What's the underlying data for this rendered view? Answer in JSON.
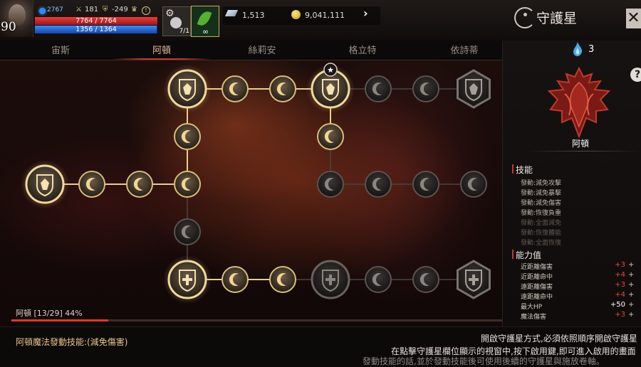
{
  "player": {
    "level": "90",
    "power": "2767",
    "stat_attack": "181",
    "stat_defense": "-249",
    "hp": "7764 / 7764",
    "mp": "1356 / 1364",
    "hp_ratio": 1.0,
    "mp_ratio": 0.994
  },
  "items": {
    "slot1_count": "7/1",
    "slot2_count": "∞"
  },
  "currency": {
    "diamond": "1,513",
    "gold": "9,041,111"
  },
  "window": {
    "title": "守護星",
    "close": "✕"
  },
  "tabs": [
    {
      "label": "宙斯",
      "active": false
    },
    {
      "label": "阿頓",
      "active": true
    },
    {
      "label": "絲莉安",
      "active": false
    },
    {
      "label": "格立特",
      "active": false
    },
    {
      "label": "依詩蒂",
      "active": false
    }
  ],
  "resource": {
    "count": "3"
  },
  "progress": {
    "label": "阿頓 [13/29] 44%",
    "value": 0.44
  },
  "panel": {
    "help": "?",
    "emblem_name": "阿頓",
    "skills_title": "技能",
    "skills": [
      {
        "label": "發動:減免攻擊",
        "active": true
      },
      {
        "label": "發動:減免暴擊",
        "active": true
      },
      {
        "label": "發動:減免傷害",
        "active": true
      },
      {
        "label": "發動:恢復負重",
        "active": true
      },
      {
        "label": "發動:全面減免",
        "active": false
      },
      {
        "label": "發動:恢復體能",
        "active": false
      },
      {
        "label": "發動:全面恢復",
        "active": false
      }
    ],
    "attrs_title": "能力值",
    "attrs": [
      {
        "label": "近距離傷害",
        "value": "+3",
        "cut": "+",
        "color": "#e24a3a"
      },
      {
        "label": "近距離命中",
        "value": "+4",
        "cut": "+",
        "color": "#e24a3a"
      },
      {
        "label": "遠距離傷害",
        "value": "+3",
        "cut": "+",
        "color": "#e24a3a"
      },
      {
        "label": "遠距離命中",
        "value": "+4",
        "cut": "+",
        "color": "#e24a3a"
      },
      {
        "label": "最大HP",
        "value": "+50",
        "cut": "+",
        "color": "#ffffff"
      },
      {
        "label": "魔法傷害",
        "value": "+3",
        "cut": "+",
        "color": "#e24a3a"
      }
    ]
  },
  "bottom": {
    "left": "阿頓魔法發動技能:(減免傷害)",
    "right_line1": "開啟守護星方式,必須依照順序開啟守護星",
    "right_line2": "在點擊守護星欄位顯示的視窗中,按下啟用鍵,即可進入啟用的畫面",
    "right_line3": "發動技能的話,並於發動技能後可使用後續的守護星與施放卷軸。"
  },
  "tree": {
    "nodes": [
      {
        "type": "big",
        "icon": "shield-wings-icon",
        "state": "active"
      },
      {
        "type": "small",
        "state": "active"
      },
      {
        "type": "small",
        "state": "active"
      },
      {
        "type": "small",
        "state": "active"
      },
      {
        "type": "small",
        "state": "active"
      },
      {
        "type": "big",
        "icon": "shield-wings-icon",
        "state": "active"
      },
      {
        "type": "small",
        "state": "active"
      },
      {
        "type": "small",
        "state": "active"
      },
      {
        "type": "big",
        "icon": "shield-wings-icon",
        "state": "active",
        "starred": true
      },
      {
        "type": "small",
        "state": "inactive"
      },
      {
        "type": "small",
        "state": "inactive"
      },
      {
        "type": "hex",
        "icon": "shield-wings-icon",
        "state": "inactive"
      },
      {
        "type": "small",
        "state": "active"
      },
      {
        "type": "small",
        "state": "inactive"
      },
      {
        "type": "small",
        "state": "inactive"
      },
      {
        "type": "small",
        "state": "inactive"
      },
      {
        "type": "small",
        "state": "inactive"
      },
      {
        "type": "small",
        "state": "inactive"
      },
      {
        "type": "small",
        "state": "active"
      },
      {
        "type": "big",
        "icon": "shield-cross-icon",
        "state": "active"
      },
      {
        "type": "small",
        "state": "active"
      },
      {
        "type": "small",
        "state": "active"
      },
      {
        "type": "big",
        "icon": "shield-cross-icon",
        "state": "inactive"
      },
      {
        "type": "small",
        "state": "inactive"
      },
      {
        "type": "small",
        "state": "inactive"
      },
      {
        "type": "hex",
        "icon": "shield-cross-icon",
        "state": "inactive"
      }
    ]
  },
  "colors": {
    "accent": "#c0392b",
    "gold": "#c9a24a",
    "node_inactive": "#2a2624"
  }
}
